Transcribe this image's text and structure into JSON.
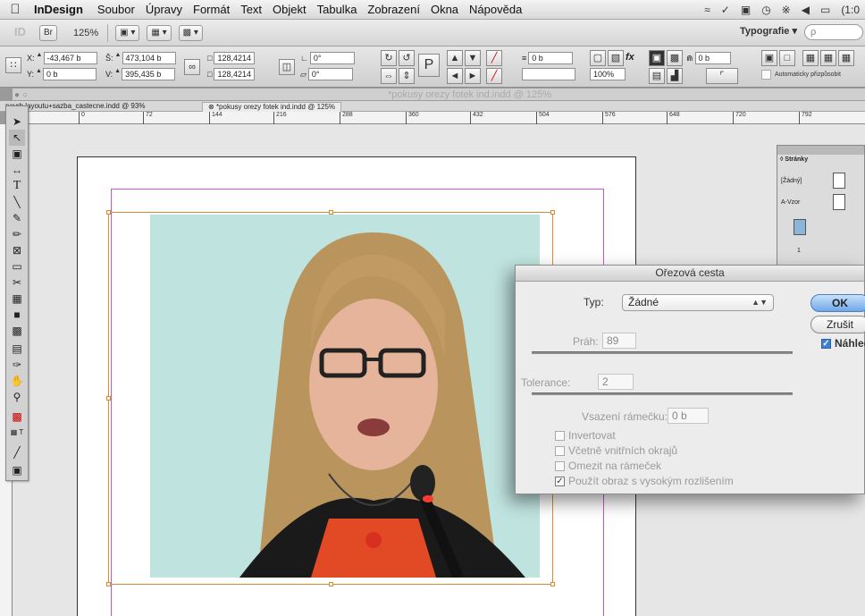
{
  "menubar": {
    "apple": "",
    "app_name": "InDesign",
    "items": [
      "Soubor",
      "Úpravy",
      "Formát",
      "Text",
      "Objekt",
      "Tabulka",
      "Zobrazení",
      "Okna",
      "Nápověda"
    ],
    "tray_battery": "(1:0"
  },
  "appbar": {
    "logo": "ID",
    "zoom": "125%",
    "workspace": "Typografie ▾",
    "search_placeholder": "ρ"
  },
  "control": {
    "x_label": "X:",
    "x_value": "-43,467 b",
    "y_label": "Y:",
    "y_value": "0 b",
    "w_label": "Š:",
    "w_value": "473,104 b",
    "h_label": "V:",
    "h_value": "395,435 b",
    "scale_x": "128,4214",
    "scale_y": "128,4214",
    "angle": "0°",
    "shear": "0°",
    "stroke": "0 b",
    "opacity": "100%",
    "fit": "0 b",
    "auto_fit": "Automaticky přizpůsobit"
  },
  "document": {
    "title": "*pokusy orezy fotek ind.indd @ 125%",
    "tabs": [
      "navrh layoutu+sazba_castecne.indd @ 93%",
      "*pokusy orezy fotek ind.indd @ 125%"
    ],
    "ruler_marks": [
      "0",
      "72",
      "144",
      "216",
      "288",
      "360",
      "432",
      "504",
      "576",
      "648",
      "720",
      "792"
    ]
  },
  "pages_panel": {
    "title": "◊ Stránky",
    "none_label": "[Žádný]",
    "master_label": "A-Vzor",
    "page_number": "1"
  },
  "dialog": {
    "title": "Ořezová cesta",
    "type_label": "Typ:",
    "type_value": "Žádné",
    "threshold_label": "Práh:",
    "threshold_value": "89",
    "tolerance_label": "Tolerance:",
    "tolerance_value": "2",
    "inset_label": "Vsazení rámečku:",
    "inset_value": "0 b",
    "ok_label": "OK",
    "cancel_label": "Zrušit",
    "preview_label": "Náhled",
    "preview_checked": true,
    "checkboxes": [
      {
        "label": "Invertovat",
        "checked": false
      },
      {
        "label": "Včetně vnitřních okrajů",
        "checked": false
      },
      {
        "label": "Omezit na rámeček",
        "checked": false
      },
      {
        "label": "Použít obraz s vysokým rozlišením",
        "checked": true
      }
    ]
  },
  "colors": {
    "frame": "#d98b33",
    "margin": "#d34fd3",
    "ok_button": "#6fa8e9"
  }
}
